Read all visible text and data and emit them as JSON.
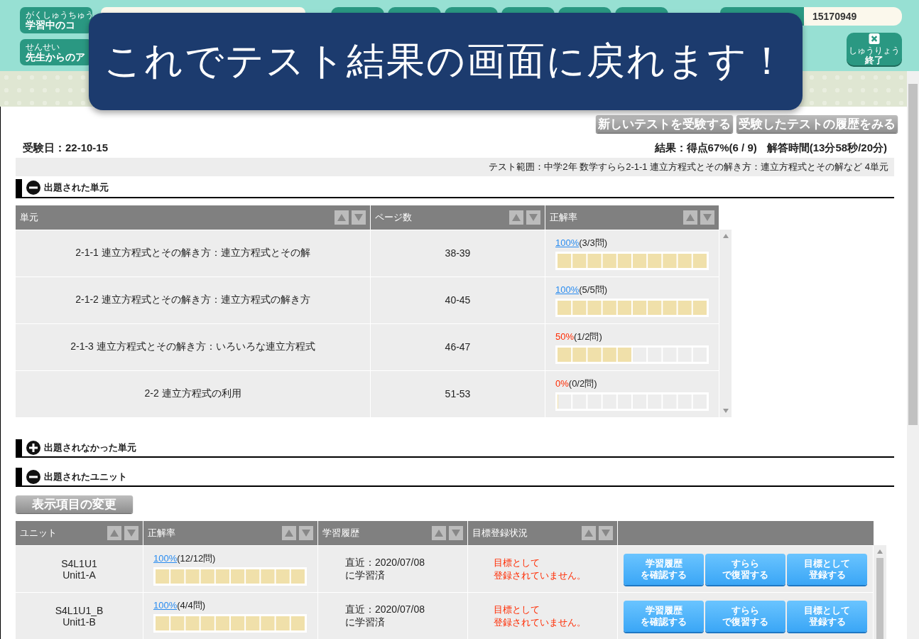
{
  "header": {
    "left_buttons": [
      {
        "ruby": "がくしゅうちゅう",
        "label": "学習中のコ"
      },
      {
        "ruby": "せんせい",
        "label": "先生からのア"
      }
    ],
    "id_field": {
      "value": "15170949"
    },
    "quit_button": {
      "ruby": "しゅうりょう",
      "label": "終了"
    }
  },
  "overlay": {
    "message": "これでテスト結果の画面に戻れます！"
  },
  "actions": [
    "新しいテストを受験する",
    "受験したテストの履歴をみる"
  ],
  "exam_date": "受験日：22-10-15",
  "result_score": "結果：得点67%(6 / 9)",
  "answer_time": "解答時間(13分58秒/20分)",
  "scope": "テスト範囲：中学2年 数学すらら2-1-1 連立方程式とその解き方：連立方程式とその解など 4単元",
  "sections": [
    {
      "kind": "units",
      "title": "出題された単元",
      "expanded": true,
      "columns": [
        "単元",
        "ページ数",
        "正解率"
      ],
      "rows": [
        {
          "unit": "2-1-1 連立方程式とその解き方：連立方程式とその解",
          "pages": "38-39",
          "pct": "100%",
          "count": "(3/3問)",
          "kind": "link",
          "level": 1
        },
        {
          "unit": "2-1-2 連立方程式とその解き方：連立方程式の解き方",
          "pages": "40-45",
          "pct": "100%",
          "count": "(5/5問)",
          "kind": "link",
          "level": 1
        },
        {
          "unit": "2-1-3 連立方程式とその解き方：いろいろな連立方程式",
          "pages": "46-47",
          "pct": "50%",
          "count": "(1/2問)",
          "kind": "alert",
          "level": 0.5
        },
        {
          "unit": "2-2 連立方程式の利用",
          "pages": "51-53",
          "pct": "0%",
          "count": "(0/2問)",
          "kind": "alert",
          "level": 0
        }
      ]
    },
    {
      "kind": "none",
      "title": "出題されなかった単元",
      "expanded": false
    },
    {
      "kind": "unit_table",
      "title": "出題されたユニット",
      "expanded": true,
      "change_button": "表示項目の変更",
      "columns": [
        "ユニット",
        "正解率",
        "学習履歴",
        "目標登録状況"
      ],
      "rows": [
        {
          "code": "S4L1U1",
          "name": "Unit1-A",
          "pct": "100%",
          "count": "(12/12問)",
          "kind": "link",
          "level": 1,
          "history": [
            "直近：2020/07/08",
            "に学習済"
          ],
          "status": [
            "目標として",
            "登録されていません。"
          ],
          "buttons": [
            [
              "学習履歴",
              "を確認する"
            ],
            [
              "すらら",
              "で復習する"
            ],
            [
              "目標として",
              "登録する"
            ]
          ]
        },
        {
          "code": "S4L1U1_B",
          "name": "Unit1-B",
          "pct": "100%",
          "count": "(4/4問)",
          "kind": "link",
          "level": 1,
          "history": [
            "直近：2020/07/08",
            "に学習済"
          ],
          "status": [
            "目標として",
            "登録されていません。"
          ],
          "buttons": [
            [
              "学習履歴",
              "を確認する"
            ],
            [
              "すらら",
              "で復習する"
            ],
            [
              "目標として",
              "登録する"
            ]
          ]
        }
      ]
    }
  ]
}
